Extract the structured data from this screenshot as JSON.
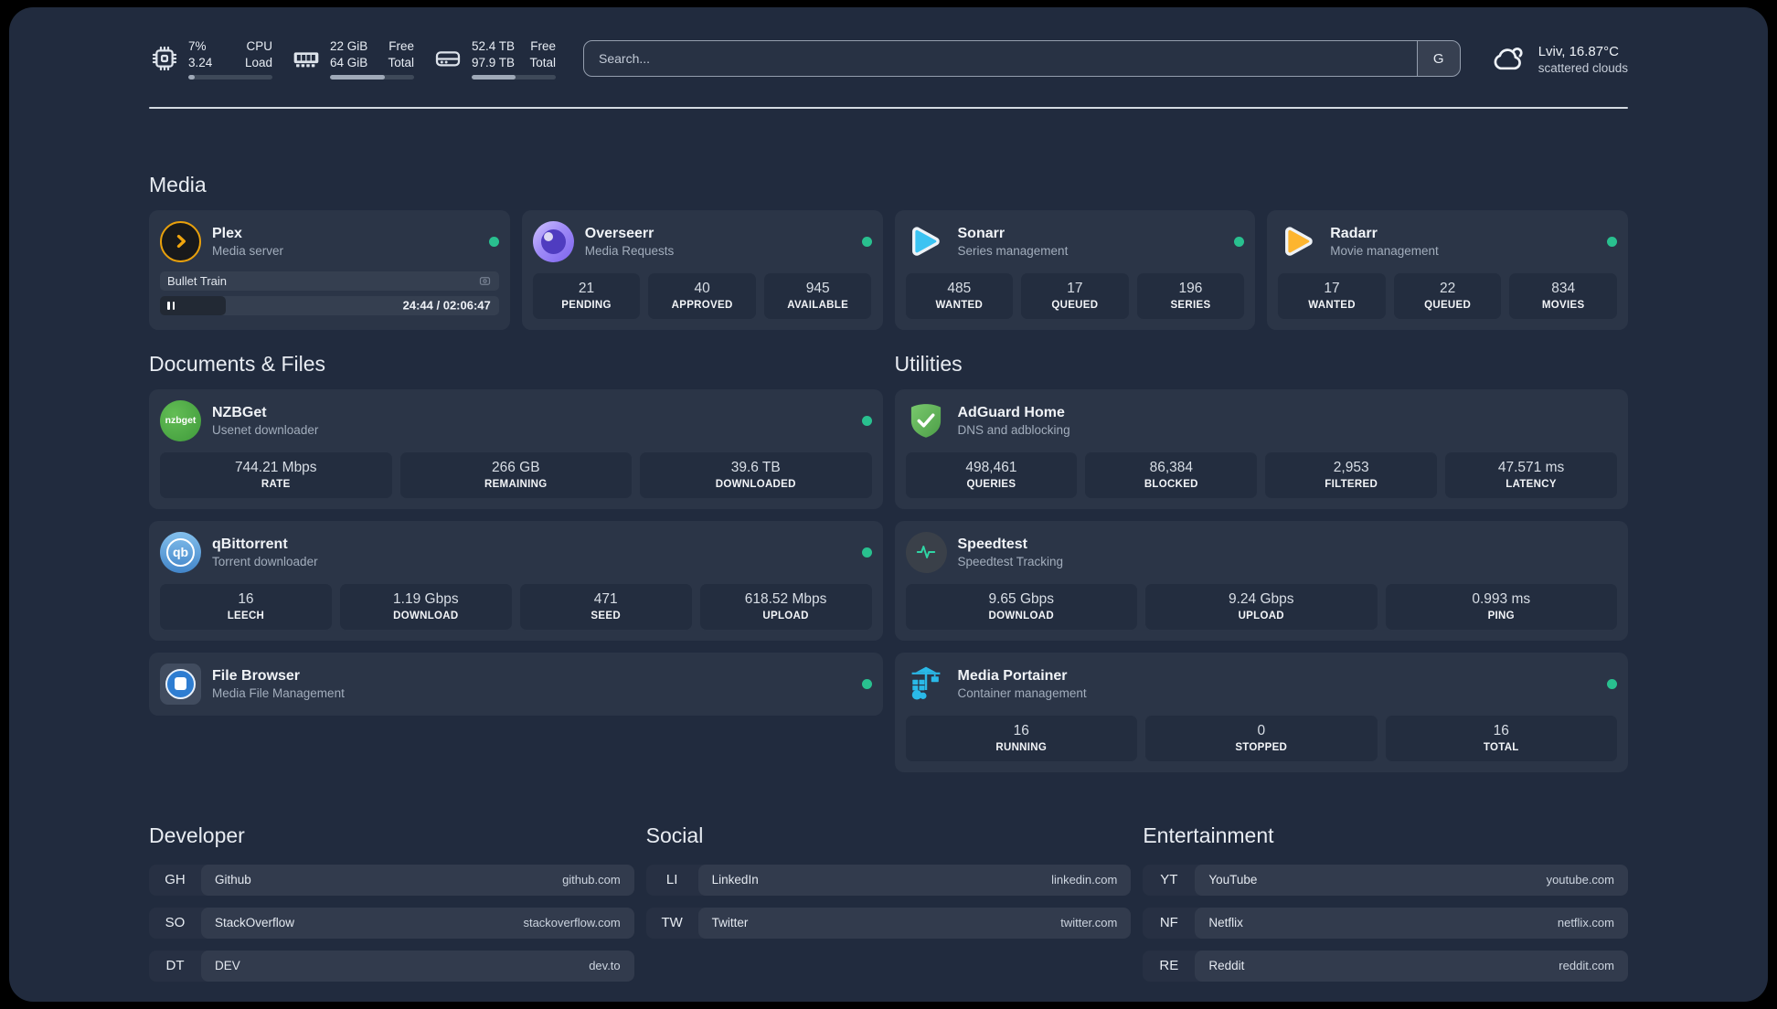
{
  "colors": {
    "accent_green": "#29c08f",
    "page_bg": "#212b3e",
    "card_bg": "#2b3547"
  },
  "header": {
    "stats": [
      {
        "icon": "cpu-icon",
        "value1": "7%",
        "value2": "3.24",
        "label1": "CPU",
        "label2": "Load",
        "progress": 8
      },
      {
        "icon": "memory-icon",
        "value1": "22 GiB",
        "value2": "64 GiB",
        "label1": "Free",
        "label2": "Total",
        "progress": 65
      },
      {
        "icon": "disk-icon",
        "value1": "52.4 TB",
        "value2": "97.9 TB",
        "label1": "Free",
        "label2": "Total",
        "progress": 52
      }
    ],
    "search": {
      "placeholder": "Search...",
      "button": "G"
    },
    "weather": {
      "location": "Lviv, 16.87°C",
      "condition": "scattered clouds"
    }
  },
  "media": {
    "title": "Media",
    "plex": {
      "title": "Plex",
      "subtitle": "Media server",
      "now_playing": "Bullet Train",
      "time": "24:44 / 02:06:47",
      "progress": 19.5
    },
    "overseerr": {
      "title": "Overseerr",
      "subtitle": "Media Requests",
      "stats": [
        {
          "value": "21",
          "label": "PENDING"
        },
        {
          "value": "40",
          "label": "APPROVED"
        },
        {
          "value": "945",
          "label": "AVAILABLE"
        }
      ]
    },
    "sonarr": {
      "title": "Sonarr",
      "subtitle": "Series management",
      "stats": [
        {
          "value": "485",
          "label": "WANTED"
        },
        {
          "value": "17",
          "label": "QUEUED"
        },
        {
          "value": "196",
          "label": "SERIES"
        }
      ]
    },
    "radarr": {
      "title": "Radarr",
      "subtitle": "Movie management",
      "stats": [
        {
          "value": "17",
          "label": "WANTED"
        },
        {
          "value": "22",
          "label": "QUEUED"
        },
        {
          "value": "834",
          "label": "MOVIES"
        }
      ]
    }
  },
  "documents": {
    "title": "Documents & Files",
    "nzbget": {
      "title": "NZBGet",
      "subtitle": "Usenet downloader",
      "icon_label": "nzbget",
      "stats": [
        {
          "value": "744.21 Mbps",
          "label": "RATE"
        },
        {
          "value": "266 GB",
          "label": "REMAINING"
        },
        {
          "value": "39.6 TB",
          "label": "DOWNLOADED"
        }
      ]
    },
    "qbittorrent": {
      "title": "qBittorrent",
      "subtitle": "Torrent downloader",
      "icon_label": "qb",
      "stats": [
        {
          "value": "16",
          "label": "LEECH"
        },
        {
          "value": "1.19 Gbps",
          "label": "DOWNLOAD"
        },
        {
          "value": "471",
          "label": "SEED"
        },
        {
          "value": "618.52 Mbps",
          "label": "UPLOAD"
        }
      ]
    },
    "filebrowser": {
      "title": "File Browser",
      "subtitle": "Media File Management"
    }
  },
  "utilities": {
    "title": "Utilities",
    "adguard": {
      "title": "AdGuard Home",
      "subtitle": "DNS and adblocking",
      "stats": [
        {
          "value": "498,461",
          "label": "QUERIES"
        },
        {
          "value": "86,384",
          "label": "BLOCKED"
        },
        {
          "value": "2,953",
          "label": "FILTERED"
        },
        {
          "value": "47.571 ms",
          "label": "LATENCY"
        }
      ]
    },
    "speedtest": {
      "title": "Speedtest",
      "subtitle": "Speedtest Tracking",
      "stats": [
        {
          "value": "9.65 Gbps",
          "label": "DOWNLOAD"
        },
        {
          "value": "9.24 Gbps",
          "label": "UPLOAD"
        },
        {
          "value": "0.993 ms",
          "label": "PING"
        }
      ]
    },
    "portainer": {
      "title": "Media Portainer",
      "subtitle": "Container management",
      "stats": [
        {
          "value": "16",
          "label": "RUNNING"
        },
        {
          "value": "0",
          "label": "STOPPED"
        },
        {
          "value": "16",
          "label": "TOTAL"
        }
      ]
    }
  },
  "bookmarks": [
    {
      "title": "Developer",
      "items": [
        {
          "abbr": "GH",
          "name": "Github",
          "url": "github.com"
        },
        {
          "abbr": "SO",
          "name": "StackOverflow",
          "url": "stackoverflow.com"
        },
        {
          "abbr": "DT",
          "name": "DEV",
          "url": "dev.to"
        }
      ]
    },
    {
      "title": "Social",
      "items": [
        {
          "abbr": "LI",
          "name": "LinkedIn",
          "url": "linkedin.com"
        },
        {
          "abbr": "TW",
          "name": "Twitter",
          "url": "twitter.com"
        }
      ]
    },
    {
      "title": "Entertainment",
      "items": [
        {
          "abbr": "YT",
          "name": "YouTube",
          "url": "youtube.com"
        },
        {
          "abbr": "NF",
          "name": "Netflix",
          "url": "netflix.com"
        },
        {
          "abbr": "RE",
          "name": "Reddit",
          "url": "reddit.com"
        }
      ]
    }
  ]
}
